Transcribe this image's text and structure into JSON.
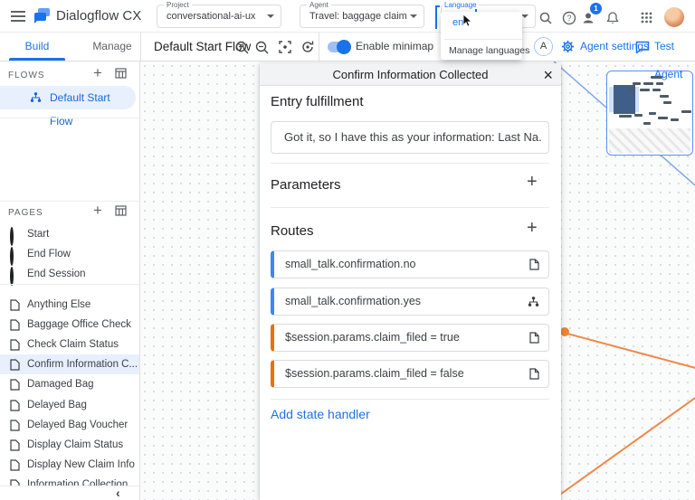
{
  "header": {
    "app_title": "Dialogflow CX",
    "project": {
      "label": "Project",
      "value": "conversational-ai-ux"
    },
    "agent": {
      "label": "Agent",
      "value": "Travel: baggage claim"
    },
    "language": {
      "label": "Language"
    },
    "notifications_badge": "1"
  },
  "language_menu": {
    "selected": "en",
    "manage": "Manage languages"
  },
  "toolbar": {
    "tabs": {
      "build": "Build",
      "manage": "Manage"
    },
    "flow_title": "Default Start Flow",
    "minimap_toggle": "Enable minimap",
    "version_badge": "A",
    "agent_settings": "Agent settings",
    "test_agent": "Test Agent"
  },
  "sidebar": {
    "flows": {
      "title": "FLOWS",
      "selected_flow": "Default Start Flow"
    },
    "pages": {
      "title": "PAGES",
      "system": [
        "Start",
        "End Flow",
        "End Session"
      ],
      "items": [
        "Anything Else",
        "Baggage Office Check",
        "Check Claim Status",
        "Confirm Information C...",
        "Damaged Bag",
        "Delayed Bag",
        "Delayed Bag Voucher",
        "Display Claim Status",
        "Display New Claim Info",
        "Information Collection"
      ],
      "selected": "Confirm Information C..."
    }
  },
  "panel": {
    "title": "Confirm Information Collected",
    "entry_fulfillment": {
      "heading": "Entry fulfillment",
      "message": "Got it, so I have this as your information: Last Na..."
    },
    "parameters_heading": "Parameters",
    "routes_heading": "Routes",
    "routes": [
      {
        "label": "small_talk.confirmation.no",
        "accent": "#4285f4",
        "icon": "page-icon"
      },
      {
        "label": "small_talk.confirmation.yes",
        "accent": "#4285f4",
        "icon": "flow-icon"
      },
      {
        "label": "$session.params.claim_filed = true",
        "accent": "#e8710a",
        "icon": "page-icon"
      },
      {
        "label": "$session.params.claim_filed = false",
        "accent": "#e8710a",
        "icon": "page-icon"
      }
    ],
    "add_state_handler": "Add state handler"
  },
  "colors": {
    "accent_blue": "#1a73e8",
    "route_blue": "#4285f4",
    "route_orange": "#e8710a",
    "selected_bg": "#e8f0fe",
    "connector_orange": "#ef8432",
    "minimap_border": "#5b93ee"
  },
  "icons": {
    "close": "×",
    "plus": "+",
    "collapse": "‹"
  }
}
